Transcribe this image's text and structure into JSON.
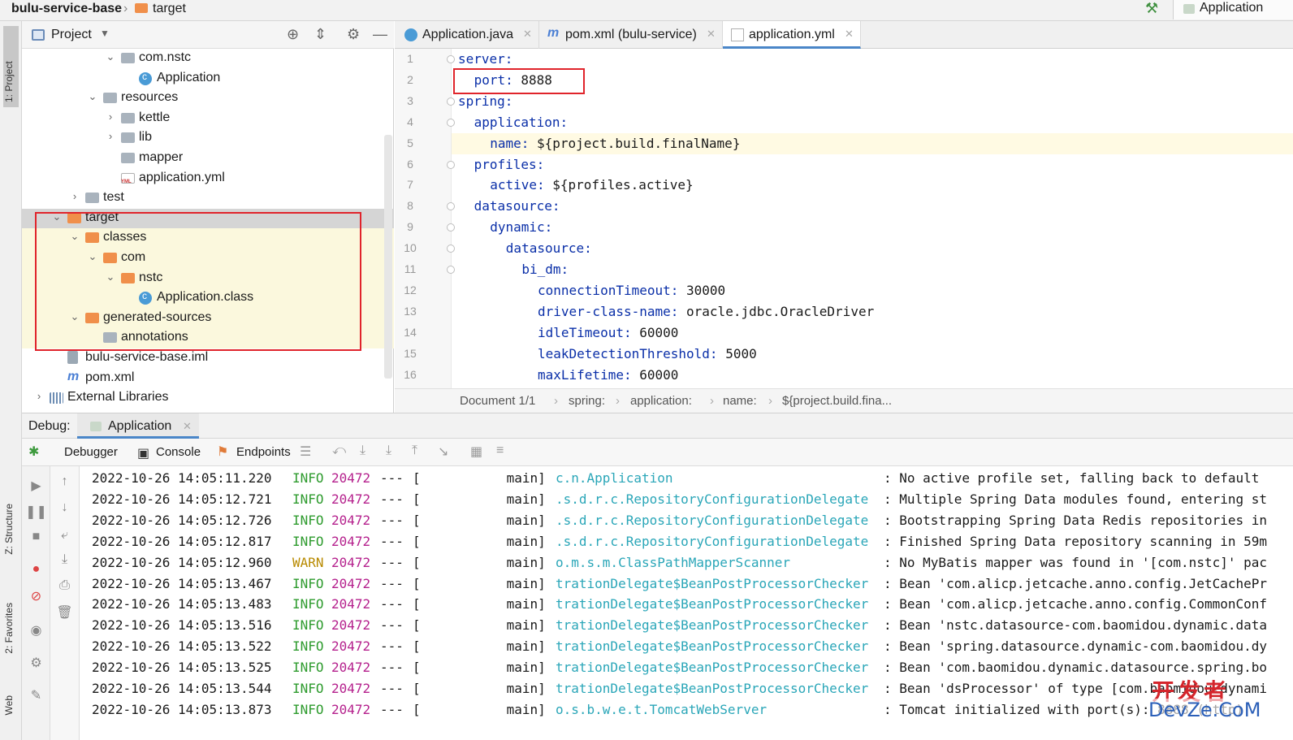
{
  "navbar": {
    "project": "bulu-service-base",
    "separator": "›",
    "folder": "target",
    "run_config": "Application"
  },
  "left_stripe": {
    "project_tab": "1: Project",
    "structure_tab": "Z: Structure",
    "favorites_tab": "2: Favorites",
    "web_tab": "Web"
  },
  "project_panel": {
    "title": "Project",
    "tree": [
      {
        "label": "com.nstc",
        "icon": "package-icon",
        "indent": 4,
        "arrow": "v"
      },
      {
        "label": "Application",
        "icon": "class-icon",
        "indent": 5,
        "arrow": ""
      },
      {
        "label": "resources",
        "icon": "folder-icon",
        "indent": 3,
        "arrow": "v"
      },
      {
        "label": "kettle",
        "icon": "folder-icon",
        "indent": 4,
        "arrow": ">"
      },
      {
        "label": "lib",
        "icon": "folder-icon",
        "indent": 4,
        "arrow": ">"
      },
      {
        "label": "mapper",
        "icon": "folder-icon",
        "indent": 4,
        "arrow": ""
      },
      {
        "label": "application.yml",
        "icon": "yml-icon",
        "indent": 4,
        "arrow": ""
      },
      {
        "label": "test",
        "icon": "folder-icon",
        "indent": 2,
        "arrow": ">"
      },
      {
        "label": "target",
        "icon": "orange-folder-icon",
        "indent": 1,
        "arrow": "v"
      },
      {
        "label": "classes",
        "icon": "orange-folder-icon",
        "indent": 2,
        "arrow": "v"
      },
      {
        "label": "com",
        "icon": "orange-folder-icon",
        "indent": 3,
        "arrow": "v"
      },
      {
        "label": "nstc",
        "icon": "orange-folder-icon",
        "indent": 4,
        "arrow": "v"
      },
      {
        "label": "Application.class",
        "icon": "class-icon",
        "indent": 5,
        "arrow": ""
      },
      {
        "label": "generated-sources",
        "icon": "orange-folder-icon",
        "indent": 2,
        "arrow": "v"
      },
      {
        "label": "annotations",
        "icon": "folder-icon",
        "indent": 3,
        "arrow": ""
      },
      {
        "label": "bulu-service-base.iml",
        "icon": "iml-icon",
        "indent": 1,
        "arrow": ""
      },
      {
        "label": "pom.xml",
        "icon": "maven-icon",
        "indent": 1,
        "arrow": ""
      },
      {
        "label": "External Libraries",
        "icon": "libraries-icon",
        "indent": 0,
        "arrow": ">"
      }
    ]
  },
  "editor": {
    "tabs": [
      {
        "label": "Application.java",
        "icon": "class-icon"
      },
      {
        "label": "pom.xml (bulu-service)",
        "icon": "maven-icon"
      },
      {
        "label": "application.yml",
        "icon": "yml-icon"
      }
    ],
    "active_tab": "application.yml",
    "lines": [
      {
        "n": "1",
        "key": "server:",
        "val": "",
        "indent": 0
      },
      {
        "n": "2",
        "key": "port:",
        "val": " 8888",
        "indent": 1
      },
      {
        "n": "3",
        "key": "spring:",
        "val": "",
        "indent": 0
      },
      {
        "n": "4",
        "key": "application:",
        "val": "",
        "indent": 1
      },
      {
        "n": "5",
        "key": "name:",
        "val": " ${project.build.finalName}",
        "indent": 2
      },
      {
        "n": "6",
        "key": "profiles:",
        "val": "",
        "indent": 1
      },
      {
        "n": "7",
        "key": "active:",
        "val": " ${profiles.active}",
        "indent": 2
      },
      {
        "n": "8",
        "key": "datasource:",
        "val": "",
        "indent": 1
      },
      {
        "n": "9",
        "key": "dynamic:",
        "val": "",
        "indent": 2
      },
      {
        "n": "10",
        "key": "datasource:",
        "val": "",
        "indent": 3
      },
      {
        "n": "11",
        "key": "bi_dm:",
        "val": "",
        "indent": 4
      },
      {
        "n": "12",
        "key": "connectionTimeout:",
        "val": " 30000",
        "indent": 5
      },
      {
        "n": "13",
        "key": "driver-class-name:",
        "val": " oracle.jdbc.OracleDriver",
        "indent": 5
      },
      {
        "n": "14",
        "key": "idleTimeout:",
        "val": " 60000",
        "indent": 5
      },
      {
        "n": "15",
        "key": "leakDetectionThreshold:",
        "val": " 5000",
        "indent": 5
      },
      {
        "n": "16",
        "key": "maxLifetime:",
        "val": " 60000",
        "indent": 5
      }
    ],
    "breadcrumb": [
      "Document 1/1",
      "spring:",
      "application:",
      "name:",
      "${project.build.fina..."
    ]
  },
  "debug": {
    "title": "Debug:",
    "session_tab": "Application",
    "tabs": {
      "debugger": "Debugger",
      "console": "Console",
      "endpoints": "Endpoints"
    },
    "logs": [
      {
        "ts": "2022-10-26 14:05:11.220",
        "lvl": "INFO",
        "pid": "20472",
        "dash": "---",
        "thread": "[           main]",
        "cls": "c.n.Application",
        "msg": ": No active profile set, falling back to default"
      },
      {
        "ts": "2022-10-26 14:05:12.721",
        "lvl": "INFO",
        "pid": "20472",
        "dash": "---",
        "thread": "[           main]",
        "cls": ".s.d.r.c.RepositoryConfigurationDelegate",
        "msg": ": Multiple Spring Data modules found, entering st"
      },
      {
        "ts": "2022-10-26 14:05:12.726",
        "lvl": "INFO",
        "pid": "20472",
        "dash": "---",
        "thread": "[           main]",
        "cls": ".s.d.r.c.RepositoryConfigurationDelegate",
        "msg": ": Bootstrapping Spring Data Redis repositories in"
      },
      {
        "ts": "2022-10-26 14:05:12.817",
        "lvl": "INFO",
        "pid": "20472",
        "dash": "---",
        "thread": "[           main]",
        "cls": ".s.d.r.c.RepositoryConfigurationDelegate",
        "msg": ": Finished Spring Data repository scanning in 59m"
      },
      {
        "ts": "2022-10-26 14:05:12.960",
        "lvl": "WARN",
        "pid": "20472",
        "dash": "---",
        "thread": "[           main]",
        "cls": "o.m.s.m.ClassPathMapperScanner",
        "msg": ": No MyBatis mapper was found in '[com.nstc]' pac"
      },
      {
        "ts": "2022-10-26 14:05:13.467",
        "lvl": "INFO",
        "pid": "20472",
        "dash": "---",
        "thread": "[           main]",
        "cls": "trationDelegate$BeanPostProcessorChecker",
        "msg": ": Bean 'com.alicp.jetcache.anno.config.JetCachePr"
      },
      {
        "ts": "2022-10-26 14:05:13.483",
        "lvl": "INFO",
        "pid": "20472",
        "dash": "---",
        "thread": "[           main]",
        "cls": "trationDelegate$BeanPostProcessorChecker",
        "msg": ": Bean 'com.alicp.jetcache.anno.config.CommonConf"
      },
      {
        "ts": "2022-10-26 14:05:13.516",
        "lvl": "INFO",
        "pid": "20472",
        "dash": "---",
        "thread": "[           main]",
        "cls": "trationDelegate$BeanPostProcessorChecker",
        "msg": ": Bean 'nstc.datasource-com.baomidou.dynamic.data"
      },
      {
        "ts": "2022-10-26 14:05:13.522",
        "lvl": "INFO",
        "pid": "20472",
        "dash": "---",
        "thread": "[           main]",
        "cls": "trationDelegate$BeanPostProcessorChecker",
        "msg": ": Bean 'spring.datasource.dynamic-com.baomidou.dy"
      },
      {
        "ts": "2022-10-26 14:05:13.525",
        "lvl": "INFO",
        "pid": "20472",
        "dash": "---",
        "thread": "[           main]",
        "cls": "trationDelegate$BeanPostProcessorChecker",
        "msg": ": Bean 'com.baomidou.dynamic.datasource.spring.bo"
      },
      {
        "ts": "2022-10-26 14:05:13.544",
        "lvl": "INFO",
        "pid": "20472",
        "dash": "---",
        "thread": "[           main]",
        "cls": "trationDelegate$BeanPostProcessorChecker",
        "msg": ": Bean 'dsProcessor' of type [com.baomidou.dynami"
      },
      {
        "ts": "2022-10-26 14:05:13.873",
        "lvl": "INFO",
        "pid": "20472",
        "dash": "---",
        "thread": "[           main]",
        "cls": "o.s.b.w.e.t.TomcatWebServer",
        "msg": ": Tomcat initialized with port(s): 8888 (http)"
      }
    ]
  },
  "watermark": {
    "line1": "开发者",
    "line2": "DevZe.CoM"
  },
  "colors": {
    "accent": "#4a86c8",
    "highlight_box": "#e0242b",
    "info": "#2e9b2e",
    "warn": "#b88a00",
    "pid": "#b5218d",
    "logger": "#2aa6b8",
    "yaml_key": "#0a2fa8"
  }
}
